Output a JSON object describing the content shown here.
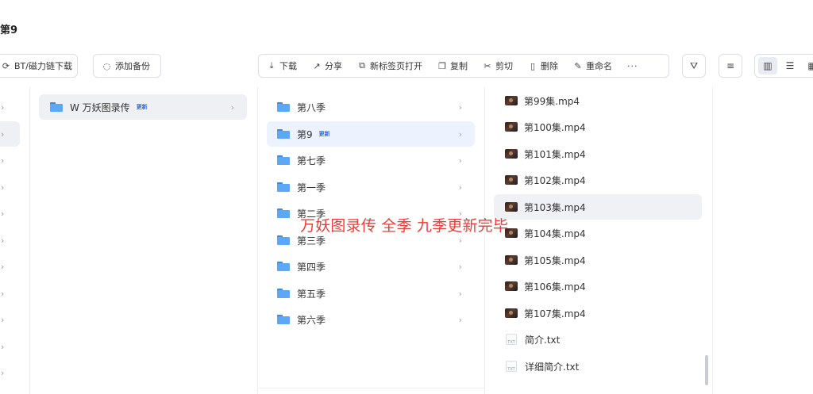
{
  "header": {
    "title": "第9"
  },
  "actions": {
    "bt_label": "BT/磁力链下载",
    "backup_label": "添加备份"
  },
  "toolbar": {
    "items": [
      {
        "label": "下载",
        "icon": "download-icon"
      },
      {
        "label": "分享",
        "icon": "share-icon"
      },
      {
        "label": "新标签页打开",
        "icon": "new-tab-icon"
      },
      {
        "label": "复制",
        "icon": "copy-icon"
      },
      {
        "label": "剪切",
        "icon": "cut-icon"
      },
      {
        "label": "删除",
        "icon": "trash-icon"
      },
      {
        "label": "重命名",
        "icon": "rename-icon"
      }
    ],
    "more": "···"
  },
  "column1": {
    "items": [
      {
        "label": "W 万妖图录传",
        "badge": "更新"
      }
    ]
  },
  "column2": {
    "items": [
      {
        "label": "第八季",
        "badge": ""
      },
      {
        "label": "第9",
        "badge": "更新"
      },
      {
        "label": "第七季",
        "badge": ""
      },
      {
        "label": "第一季",
        "badge": ""
      },
      {
        "label": "第二季",
        "badge": ""
      },
      {
        "label": "第三季",
        "badge": ""
      },
      {
        "label": "第四季",
        "badge": ""
      },
      {
        "label": "第五季",
        "badge": ""
      },
      {
        "label": "第六季",
        "badge": ""
      }
    ]
  },
  "column3": {
    "items": [
      {
        "label": "第99集.mp4",
        "type": "video"
      },
      {
        "label": "第100集.mp4",
        "type": "video"
      },
      {
        "label": "第101集.mp4",
        "type": "video"
      },
      {
        "label": "第102集.mp4",
        "type": "video"
      },
      {
        "label": "第103集.mp4",
        "type": "video"
      },
      {
        "label": "第104集.mp4",
        "type": "video"
      },
      {
        "label": "第105集.mp4",
        "type": "video"
      },
      {
        "label": "第106集.mp4",
        "type": "video"
      },
      {
        "label": "第107集.mp4",
        "type": "video"
      },
      {
        "label": "简介.txt",
        "type": "txt"
      },
      {
        "label": "详细简介.txt",
        "type": "txt"
      }
    ],
    "txt_icon_text": "TXT"
  },
  "overlay": {
    "text": "万妖图录传 全季 九季更新完毕"
  },
  "colors": {
    "accent": "#2f6ce3",
    "overlay": "#ef3b35",
    "folder": "#5aa8f6",
    "selected_blue": "#edf3fe"
  }
}
